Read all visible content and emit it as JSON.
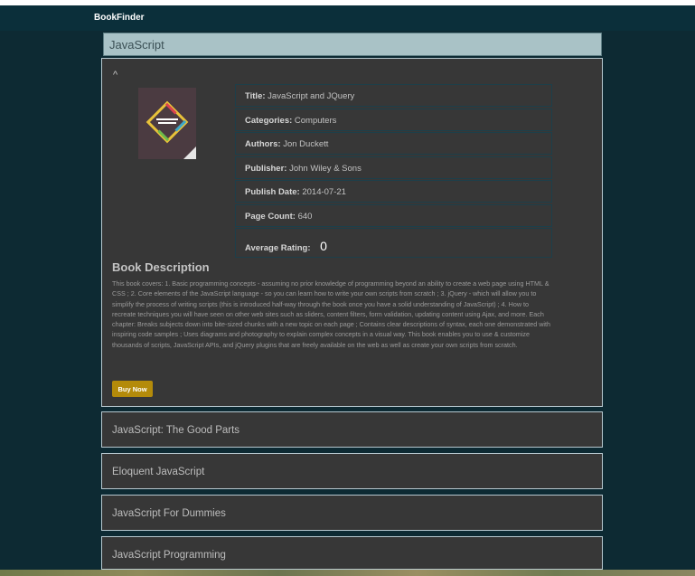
{
  "navbar": {
    "brand": "BookFinder"
  },
  "search": {
    "value": "JavaScript"
  },
  "open_book": {
    "caret": "^",
    "cover_icon": "book-cover-image",
    "info": [
      {
        "label": "Title:",
        "value": "JavaScript and JQuery"
      },
      {
        "label": "Categories:",
        "value": "Computers"
      },
      {
        "label": "Authors:",
        "value": "Jon Duckett"
      },
      {
        "label": "Publisher:",
        "value": "John Wiley & Sons"
      },
      {
        "label": "Publish Date:",
        "value": "2014-07-21"
      },
      {
        "label": "Page Count:",
        "value": "640"
      },
      {
        "label": "Average Rating:",
        "value": "0"
      }
    ],
    "description_title": "Book Description",
    "description": "This book covers: 1. Basic programming concepts - assuming no prior knowledge of programming beyond an ability to create a web page using HTML & CSS ; 2. Core elements of the JavaScript language - so you can learn how to write your own scripts from scratch ; 3. jQuery - which will allow you to simplify the process of writing scripts (this is introduced half-way through the book once you have a solid understanding of JavaScript) ; 4. How to recreate techniques you will have seen on other web sites such as sliders, content filters, form validation, updating content using Ajax, and more. Each chapter: Breaks subjects down into bite-sized chunks with a new topic on each page ; Contains clear descriptions of syntax, each one demonstrated with inspiring code samples ; Uses diagrams and photography to explain complex concepts in a visual way. This book enables you to use & customize thousands of scripts, JavaScript APIs, and jQuery plugins that are freely available on the web as well as create your own scripts from scratch.",
    "buy_label": "Buy Now"
  },
  "other_books": [
    {
      "title": "JavaScript: The Good Parts"
    },
    {
      "title": "Eloquent JavaScript"
    },
    {
      "title": "JavaScript For Dummies"
    },
    {
      "title": "JavaScript Programming"
    }
  ],
  "colors": {
    "background": "#0d2a33",
    "navbar": "#0b2f3a",
    "panel": "#373737",
    "search_bg": "#a9c2c6",
    "buy_button": "#b48b0a"
  }
}
